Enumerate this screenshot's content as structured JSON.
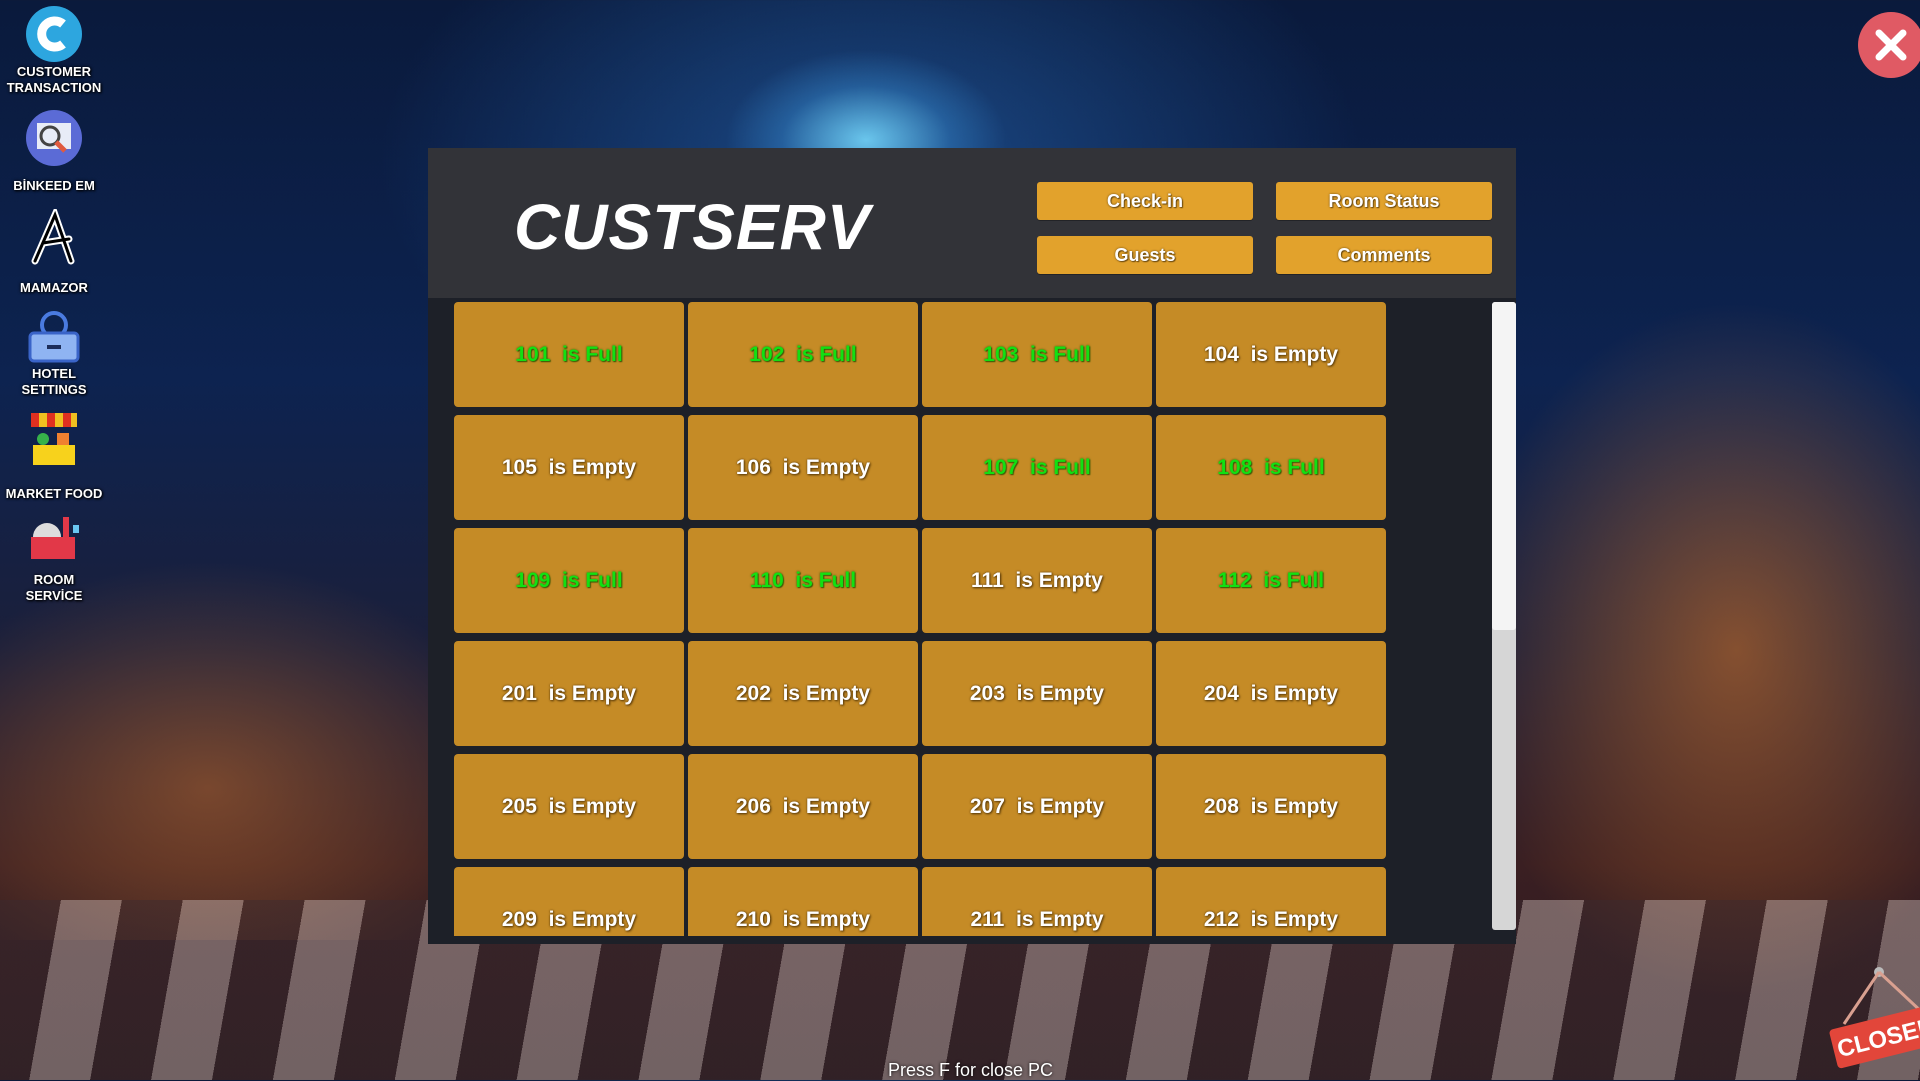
{
  "desktop_icons": [
    {
      "id": "customer-transaction",
      "label_line1": "CUSTOMER",
      "label_line2": "TRANSACTION",
      "icon": "c-letter-icon"
    },
    {
      "id": "binkeed-em",
      "label_line1": "BİNKEED EM",
      "label_line2": "",
      "icon": "job-search-icon"
    },
    {
      "id": "mamazor",
      "label_line1": "MAMAZOR",
      "label_line2": "",
      "icon": "a-letter-icon"
    },
    {
      "id": "hotel-settings",
      "label_line1": "HOTEL",
      "label_line2": "SETTINGS",
      "icon": "gear-box-icon"
    },
    {
      "id": "market-food",
      "label_line1": "MARKET FOOD",
      "label_line2": "",
      "icon": "market-stall-icon"
    },
    {
      "id": "room-service",
      "label_line1": "ROOM",
      "label_line2": "SERVİCE",
      "icon": "room-service-icon"
    }
  ],
  "app": {
    "title": "CUSTSERV",
    "buttons": {
      "checkin": "Check-in",
      "room_status": "Room Status",
      "guests": "Guests",
      "comments": "Comments"
    }
  },
  "rooms": [
    {
      "number": "101",
      "status": "Full"
    },
    {
      "number": "102",
      "status": "Full"
    },
    {
      "number": "103",
      "status": "Full"
    },
    {
      "number": "104",
      "status": "Empty"
    },
    {
      "number": "105",
      "status": "Empty"
    },
    {
      "number": "106",
      "status": "Empty"
    },
    {
      "number": "107",
      "status": "Full"
    },
    {
      "number": "108",
      "status": "Full"
    },
    {
      "number": "109",
      "status": "Full"
    },
    {
      "number": "110",
      "status": "Full"
    },
    {
      "number": "111",
      "status": "Empty"
    },
    {
      "number": "112",
      "status": "Full"
    },
    {
      "number": "201",
      "status": "Empty"
    },
    {
      "number": "202",
      "status": "Empty"
    },
    {
      "number": "203",
      "status": "Empty"
    },
    {
      "number": "204",
      "status": "Empty"
    },
    {
      "number": "205",
      "status": "Empty"
    },
    {
      "number": "206",
      "status": "Empty"
    },
    {
      "number": "207",
      "status": "Empty"
    },
    {
      "number": "208",
      "status": "Empty"
    },
    {
      "number": "209",
      "status": "Empty"
    },
    {
      "number": "210",
      "status": "Empty"
    },
    {
      "number": "211",
      "status": "Empty"
    },
    {
      "number": "212",
      "status": "Empty"
    }
  ],
  "room_text_connector": "is",
  "colors": {
    "full": "#12e012",
    "empty": "#ffffff",
    "tile": "#c58b26",
    "button": "#e2a22c",
    "close": "#e05a64"
  },
  "scroll_position_fraction": 0.0,
  "hint_text": "Press F for close PC",
  "closed_sign_text": "CLOSED"
}
